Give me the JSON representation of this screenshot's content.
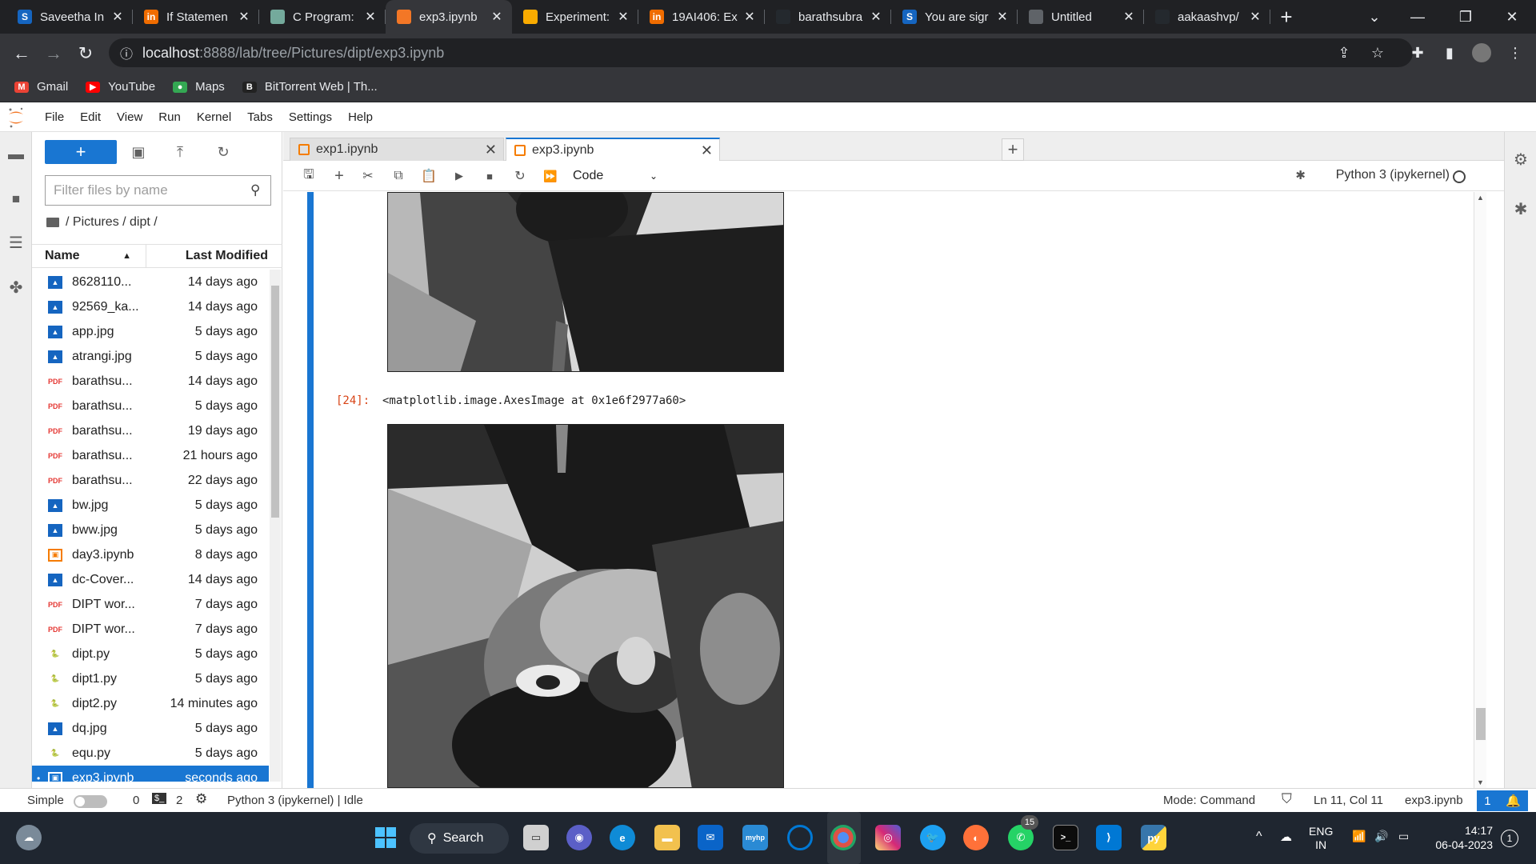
{
  "browser": {
    "tabs": [
      {
        "title": "Saveetha In",
        "favicon": "S",
        "favcolor": "#1565c0"
      },
      {
        "title": "If Statemen",
        "favicon": "in",
        "favcolor": "#ef6c00"
      },
      {
        "title": "C Program:",
        "favicon": "chatgpt-icon",
        "favcolor": "#74aa9c"
      },
      {
        "title": "exp3.ipynb",
        "favicon": "jupyter-icon",
        "favcolor": "#f37726",
        "active": true
      },
      {
        "title": "Experiment:",
        "favicon": "slides-icon",
        "favcolor": "#f9ab00"
      },
      {
        "title": "19AI406: Ex",
        "favicon": "in",
        "favcolor": "#ef6c00"
      },
      {
        "title": "barathsubra",
        "favicon": "github-icon",
        "favcolor": "#24292e"
      },
      {
        "title": "You are sigr",
        "favicon": "S",
        "favcolor": "#1565c0"
      },
      {
        "title": "Untitled",
        "favicon": "globe-icon",
        "favcolor": "#5f6368"
      },
      {
        "title": "aakaashvp/",
        "favicon": "github-icon",
        "favcolor": "#24292e"
      }
    ],
    "new_tab": "+",
    "url_host": "localhost",
    "url_path": ":8888/lab/tree/Pictures/dipt/exp3.ipynb",
    "bookmarks": [
      {
        "label": "Gmail",
        "icon": "M",
        "color": "#ea4335"
      },
      {
        "label": "YouTube",
        "icon": "▶",
        "color": "#ff0000"
      },
      {
        "label": "Maps",
        "icon": "●",
        "color": "#34a853"
      },
      {
        "label": "BitTorrent Web | Th...",
        "icon": "B",
        "color": "#222222"
      }
    ]
  },
  "jupyter": {
    "menu": [
      "File",
      "Edit",
      "View",
      "Run",
      "Kernel",
      "Tabs",
      "Settings",
      "Help"
    ],
    "filebrowser": {
      "new_button": "+",
      "filter_placeholder": "Filter files by name",
      "breadcrumb": "/ Pictures / dipt /",
      "col_name": "Name",
      "col_modified": "Last Modified",
      "files": [
        {
          "name": "8628110...",
          "type": "image",
          "modified": "14 days ago"
        },
        {
          "name": "92569_ka...",
          "type": "image",
          "modified": "14 days ago"
        },
        {
          "name": "app.jpg",
          "type": "image",
          "modified": "5 days ago"
        },
        {
          "name": "atrangi.jpg",
          "type": "image",
          "modified": "5 days ago"
        },
        {
          "name": "barathsu...",
          "type": "pdf",
          "modified": "14 days ago"
        },
        {
          "name": "barathsu...",
          "type": "pdf",
          "modified": "5 days ago"
        },
        {
          "name": "barathsu...",
          "type": "pdf",
          "modified": "19 days ago"
        },
        {
          "name": "barathsu...",
          "type": "pdf",
          "modified": "21 hours ago"
        },
        {
          "name": "barathsu...",
          "type": "pdf",
          "modified": "22 days ago"
        },
        {
          "name": "bw.jpg",
          "type": "image",
          "modified": "5 days ago"
        },
        {
          "name": "bww.jpg",
          "type": "image",
          "modified": "5 days ago"
        },
        {
          "name": "day3.ipynb",
          "type": "notebook",
          "modified": "8 days ago"
        },
        {
          "name": "dc-Cover...",
          "type": "image",
          "modified": "14 days ago"
        },
        {
          "name": "DIPT wor...",
          "type": "pdf",
          "modified": "7 days ago"
        },
        {
          "name": "DIPT wor...",
          "type": "pdf",
          "modified": "7 days ago"
        },
        {
          "name": "dipt.py",
          "type": "python",
          "modified": "5 days ago"
        },
        {
          "name": "dipt1.py",
          "type": "python",
          "modified": "5 days ago"
        },
        {
          "name": "dipt2.py",
          "type": "python",
          "modified": "14 minutes ago"
        },
        {
          "name": "dq.jpg",
          "type": "image",
          "modified": "5 days ago"
        },
        {
          "name": "equ.py",
          "type": "python",
          "modified": "5 days ago"
        },
        {
          "name": "exp3.ipynb",
          "type": "notebook",
          "modified": "seconds ago",
          "selected": true
        }
      ]
    },
    "notebook_tabs": [
      {
        "title": "exp1.ipynb"
      },
      {
        "title": "exp3.ipynb",
        "active": true
      }
    ],
    "toolbar": {
      "cell_type": "Code",
      "kernel": "Python 3 (ipykernel)"
    },
    "output": {
      "prompt": "[24]:",
      "text": "<matplotlib.image.AxesImage at 0x1e6f2977a60>"
    },
    "statusbar": {
      "simple_label": "Simple",
      "terminals": "0",
      "kernels": "2",
      "kernel_status": "Python 3 (ipykernel) | Idle",
      "mode": "Mode: Command",
      "position": "Ln 11, Col 11",
      "filename": "exp3.ipynb",
      "notifications": "1"
    }
  },
  "taskbar": {
    "search_label": "Search",
    "lang_line1": "ENG",
    "lang_line2": "IN",
    "time": "14:17",
    "date": "06-04-2023",
    "whatsapp_badge": "15",
    "notif_count": "1"
  }
}
